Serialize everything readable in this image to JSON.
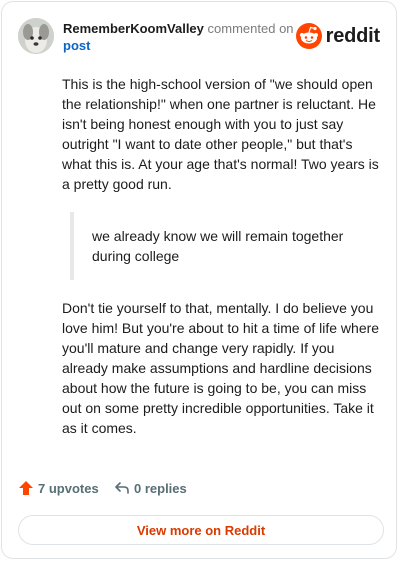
{
  "header": {
    "author": "RememberKoomValley",
    "action": "commented on",
    "target": "post",
    "logo_text": "reddit",
    "brand_color": "#ff4500"
  },
  "comment": {
    "paragraph1": "This is the high-school version of \"we should open the relationship!\" when one partner is reluctant. He isn't being honest enough with you to just say outright \"I want to date other people,\" but that's what this is. At your age that's normal! Two years is a pretty good run.",
    "quote": "we already know we will remain together during college",
    "paragraph2": "Don't tie yourself to that, mentally. I do believe you love him! But you're about to hit a time of life where you'll mature and change very rapidly. If you already make assumptions and hardline decisions about how the future is going to be, you can miss out on some pretty incredible opportunities. Take it as it comes."
  },
  "footer": {
    "upvotes": "7 upvotes",
    "replies": "0 replies",
    "upvote_icon": "upvote-arrow-icon",
    "reply_icon": "reply-arrow-icon",
    "upvote_color": "#ff4500"
  },
  "view_more": "View more on Reddit"
}
